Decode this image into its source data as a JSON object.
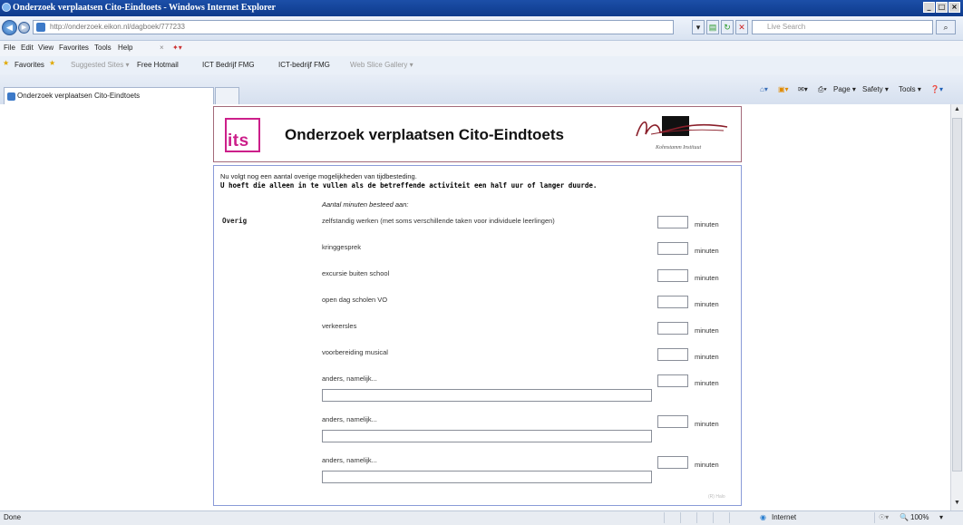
{
  "window": {
    "title": "Onderzoek verplaatsen Cito-Eindtoets - Windows Internet Explorer",
    "controls": [
      "_",
      "□",
      "×"
    ]
  },
  "address_bar": {
    "url": "http://onderzoek.eikon.nl/dagboek/777233",
    "search_placeholder": "Live Search"
  },
  "menu": [
    "File",
    "Edit",
    "View",
    "Favorites",
    "Tools",
    "Help"
  ],
  "favorites_bar": {
    "favorites_label": "Favorites",
    "links": [
      "Suggested Sites ▾",
      "Free Hotmail",
      "ICT Bedrijf FMG",
      "ICT-bedrijf FMG",
      "Web Slice Gallery ▾"
    ]
  },
  "tabs": [
    {
      "label": "Onderzoek verplaatsen Cito-Eindtoets"
    }
  ],
  "command_bar": [
    "Page ▾",
    "Safety ▾",
    "Tools ▾"
  ],
  "page": {
    "logo_text": "its",
    "title": "Onderzoek verplaatsen Cito-Eindtoets",
    "signature_caption": "Kohnstamm Instituut",
    "intro_line1": "Nu volgt nog een aantal overige mogelijkheden van tijdbesteding.",
    "intro_line2": "U hoeft die alleen in te vullen als de betreffende activiteit een half uur of langer duurde.",
    "column_header": "Aantal minuten besteed aan:",
    "row_label": "Overig",
    "unit": "minuten",
    "activities": [
      "zelfstandig werken (met soms verschillende taken voor individuele leerlingen)",
      "kringgesprek",
      "excursie buiten school",
      "open dag scholen VO",
      "verkeersles",
      "voorbereiding musical",
      "anders, namelijk...",
      "anders, namelijk...",
      "anders, namelijk..."
    ],
    "footer_text": "(R) Halo"
  },
  "status_bar": {
    "left": "Done",
    "zone": "Internet",
    "zoom": "100%"
  },
  "colors": {
    "logo_accent": "#cc1f8a",
    "form_border": "#8a9bd8",
    "header_border": "#a36a7a",
    "titlebar": "#0d3a8c"
  }
}
